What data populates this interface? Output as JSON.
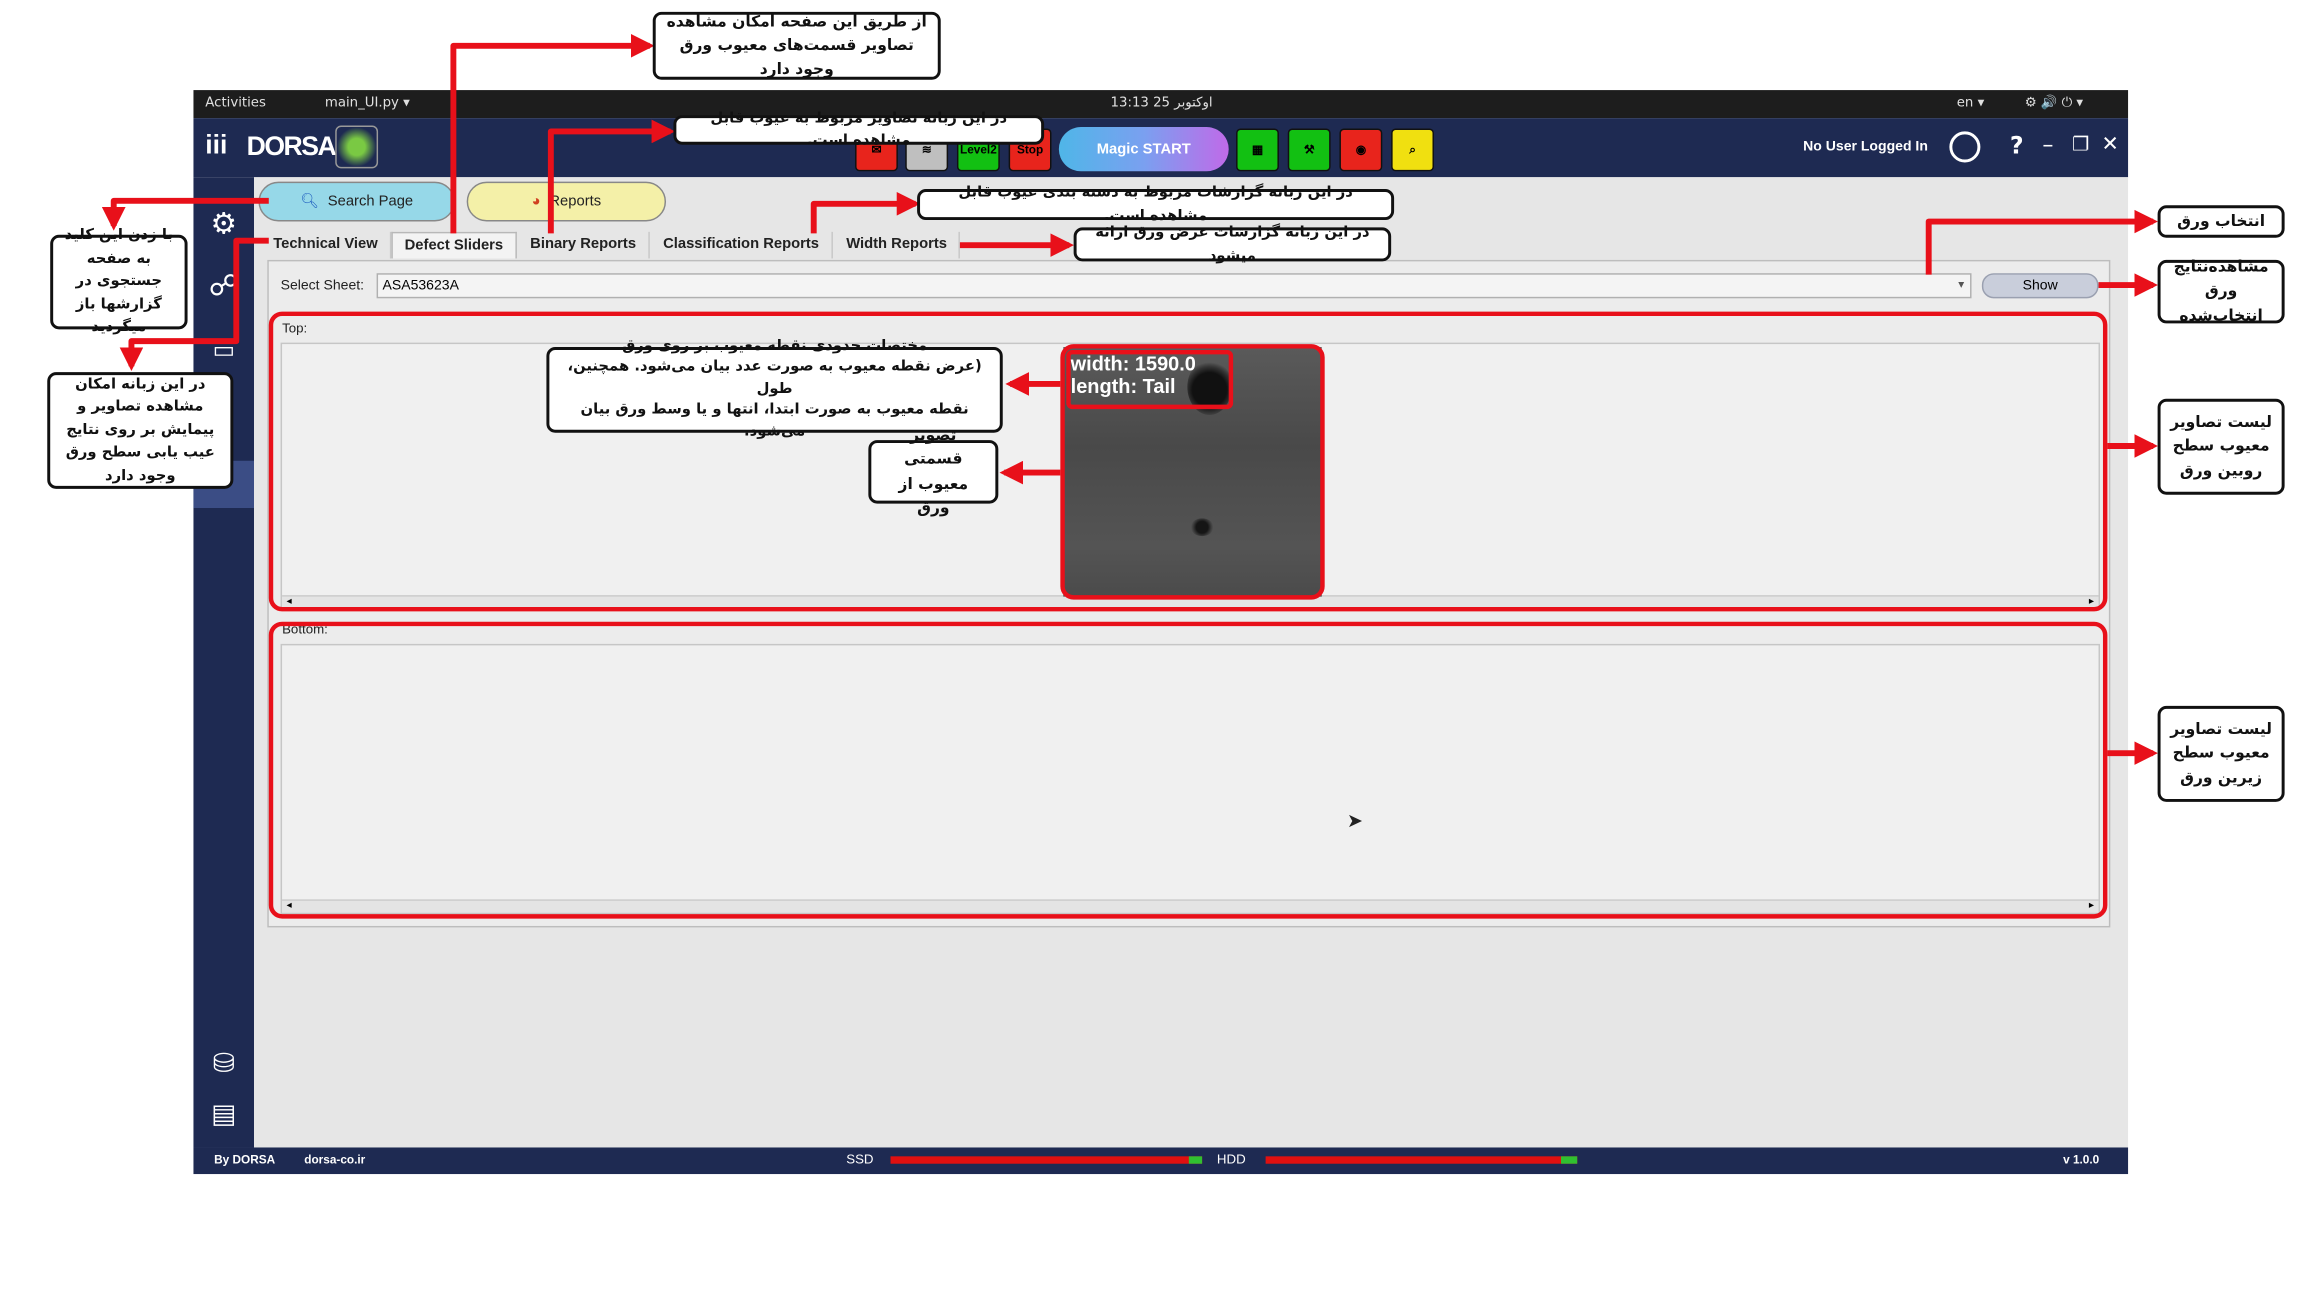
{
  "os_bar": {
    "activities": "Activities",
    "app_menu": "main_UI.py ▾",
    "clock": "اوکتوبر 25  13:13",
    "lang": "en ▾",
    "system_icons": "⚙ 🔊 ⏻ ▾"
  },
  "header": {
    "logo_text": "DORSA",
    "logo_prefix": "iii",
    "buttons": [
      {
        "name": "mail-icon",
        "label": "",
        "color": "#e8241c"
      },
      {
        "name": "layers-icon",
        "label": "",
        "color": "#bfbfbf"
      },
      {
        "name": "level2-button",
        "label": "Level2",
        "color": "#12c012"
      },
      {
        "name": "stop-button",
        "label": "Stop",
        "color": "#e8241c"
      }
    ],
    "magic_start": "Magic START",
    "right_buttons": [
      {
        "name": "camera-settings-icon",
        "color": "#12c012"
      },
      {
        "name": "tools-icon",
        "color": "#12c012"
      },
      {
        "name": "camera-icon",
        "color": "#e8241c"
      },
      {
        "name": "image-search-icon",
        "color": "#f0e010"
      }
    ],
    "user_status": "No User Logged In",
    "help": "?",
    "minimize": "–",
    "restore": "❐",
    "close": "✕"
  },
  "toolbar": {
    "search_page": "Search Page",
    "reports": "Reports"
  },
  "tabs": [
    {
      "label": "Technical View"
    },
    {
      "label": "Defect Sliders"
    },
    {
      "label": "Binary Reports"
    },
    {
      "label": "Classification Reports"
    },
    {
      "label": "Width Reports"
    }
  ],
  "sheet_select": {
    "label": "Select Sheet:",
    "value": "ASA53623A",
    "show_button": "Show"
  },
  "top_panel": {
    "label": "Top:",
    "defect_image": {
      "width_text": "width:  1590.0",
      "length_text": "length:  Tail"
    }
  },
  "bottom_panel": {
    "label": "Bottom:"
  },
  "footer": {
    "by": "By DORSA",
    "site": "dorsa-co.ir",
    "ssd": "SSD",
    "hdd": "HDD",
    "version": "v 1.0.0",
    "ssd_usage": 0.98,
    "hdd_usage": 0.97
  },
  "annotations": {
    "defect_sliders_note": "از طریق این صفحه امکان مشاهده تصاویر قسمت‌های معیوب ورق وجود دارد",
    "binary_reports_note": "در این زبانه تصاویر مربوط به عیوب قابل مشاهده است.",
    "classification_note": "در این زبانه گزارشات مربوط به دسته بندی عیوب قابل مشاهده است.",
    "width_note": "در این زبانه گزارشات عرض ورق ارائه میشود",
    "search_note": "با زدن این کلید به صفحه جستجوی در گزارشها باز میگردید",
    "technical_note": "در این زبانه امکان مشاهده تصاویر و پیمایش بر روی نتایج عیب یابی سطح ورق وجود دارد",
    "select_sheet_note": "انتخاب ورق",
    "show_note": "مشاهده‌نتایج ورق انتخاب‌شده",
    "top_list_note": "لیست تصاویر معیوب سطح روبین ورق",
    "bottom_list_note": "لیست تصاویر معیوب سطح زیرین ورق",
    "coords_note_1": "مختصات حدودی نقطه معیوب بر روی ورق",
    "coords_note_2": "(عرض نقطه معیوب به صورت عدد بیان می‌شود. همچنین، طول",
    "coords_note_3": "نقطه معیوب به صورت ابتدا، انتها و یا وسط ورق بیان می‌شود.",
    "crop_note": "تصویر قسمتی معیوب از ورق"
  }
}
